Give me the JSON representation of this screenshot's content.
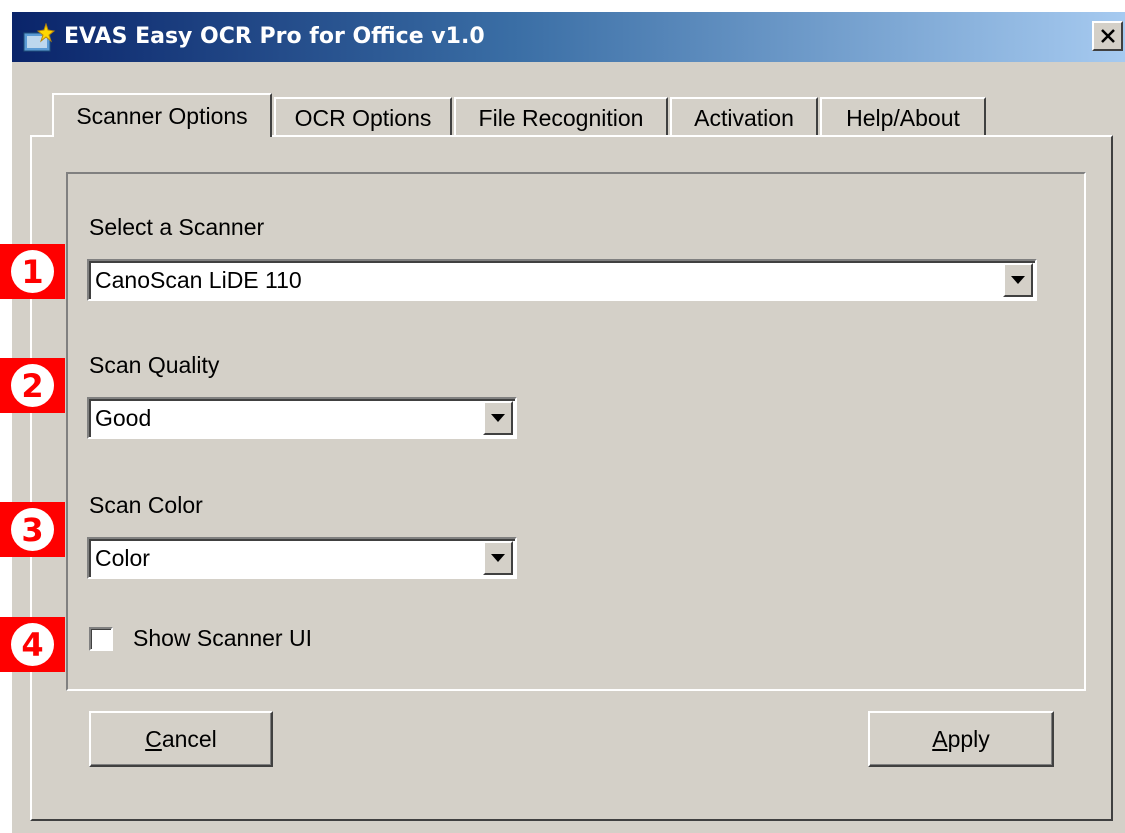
{
  "window": {
    "title": "EVAS Easy OCR Pro for Office v1.0",
    "close_glyph": "✕"
  },
  "tabs": [
    {
      "label": "Scanner Options",
      "active": true
    },
    {
      "label": "OCR Options",
      "active": false
    },
    {
      "label": "File Recognition",
      "active": false
    },
    {
      "label": "Activation",
      "active": false
    },
    {
      "label": "Help/About",
      "active": false
    }
  ],
  "scanner": {
    "label": "Select a Scanner",
    "value": "CanoScan LiDE 110"
  },
  "quality": {
    "label": "Scan Quality",
    "value": "Good"
  },
  "color": {
    "label": "Scan Color",
    "value": "Color"
  },
  "show_ui": {
    "label": "Show Scanner UI",
    "checked": false
  },
  "badges": [
    "1",
    "2",
    "3",
    "4"
  ],
  "buttons": {
    "cancel": {
      "mnemonic": "C",
      "rest": "ancel"
    },
    "apply": {
      "mnemonic": "A",
      "rest": "pply"
    }
  },
  "colors": {
    "badge": "#ff0000",
    "face": "#d4d0c8",
    "title_start": "#0a246a",
    "title_end": "#a6caf0"
  },
  "icons": {
    "app": "app-sparkle-icon",
    "close": "close-icon",
    "dropdown": "chevron-down-icon"
  }
}
